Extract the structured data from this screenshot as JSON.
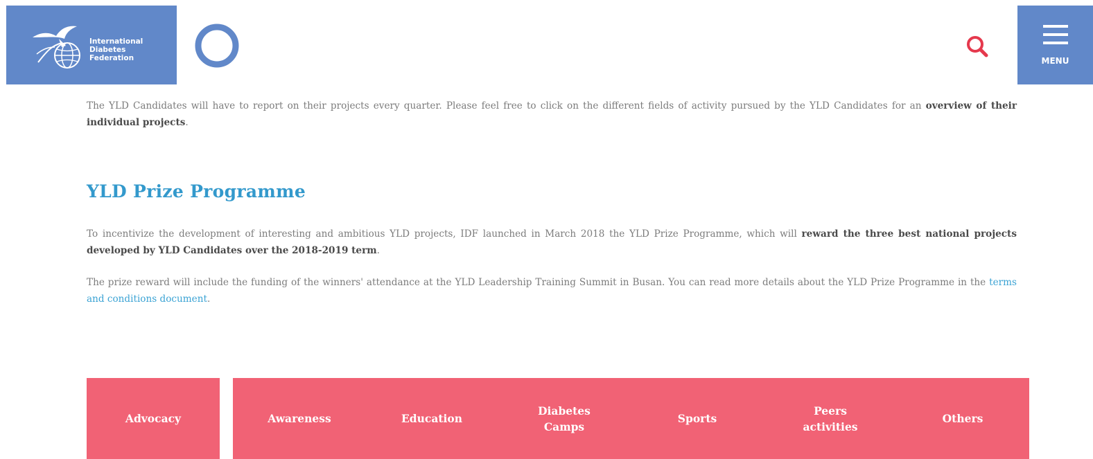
{
  "header": {
    "org_name_lines": [
      "International",
      "Diabetes",
      "Federation"
    ],
    "menu_label": "MENU",
    "icons": {
      "logo": "idf-globe-bird-logo",
      "circle": "blue-circle-logo",
      "search": "search-icon",
      "menu": "hamburger-icon"
    },
    "colors": {
      "brand_blue": "#6188c9",
      "search_red": "#e5394d"
    }
  },
  "intro": {
    "text_before": "The YLD Candidates will have to report on their projects every quarter. Please feel free to click on the different fields of activity pursued by the YLD Candidates for an ",
    "bold": "overview of their individual projects",
    "text_after": "."
  },
  "prize": {
    "heading": "YLD Prize Programme",
    "p1_text": "To incentivize the development of interesting and ambitious YLD projects, IDF launched in March 2018 the YLD Prize Programme, which will ",
    "p1_bold": "reward the three best national projects developed by YLD Candidates over the 2018-2019 term",
    "p1_end": ".",
    "p2_text": "The prize reward will include the funding of the winners' attendance at the YLD Leadership Training Summit in Busan. You can read more details about the YLD Prize Programme in the ",
    "p2_link": "terms and conditions document",
    "p2_end": "."
  },
  "tiles": [
    {
      "lines": [
        "Advocacy"
      ]
    },
    {
      "lines": [
        "Awareness"
      ]
    },
    {
      "lines": [
        "Education"
      ]
    },
    {
      "lines": [
        "Diabetes",
        "Camps"
      ]
    },
    {
      "lines": [
        "Sports"
      ]
    },
    {
      "lines": [
        "Peers",
        "activities"
      ]
    },
    {
      "lines": [
        "Others"
      ]
    }
  ],
  "tile_color": "#f16275",
  "heading_color": "#3399cc",
  "link_color": "#3ba3d4"
}
